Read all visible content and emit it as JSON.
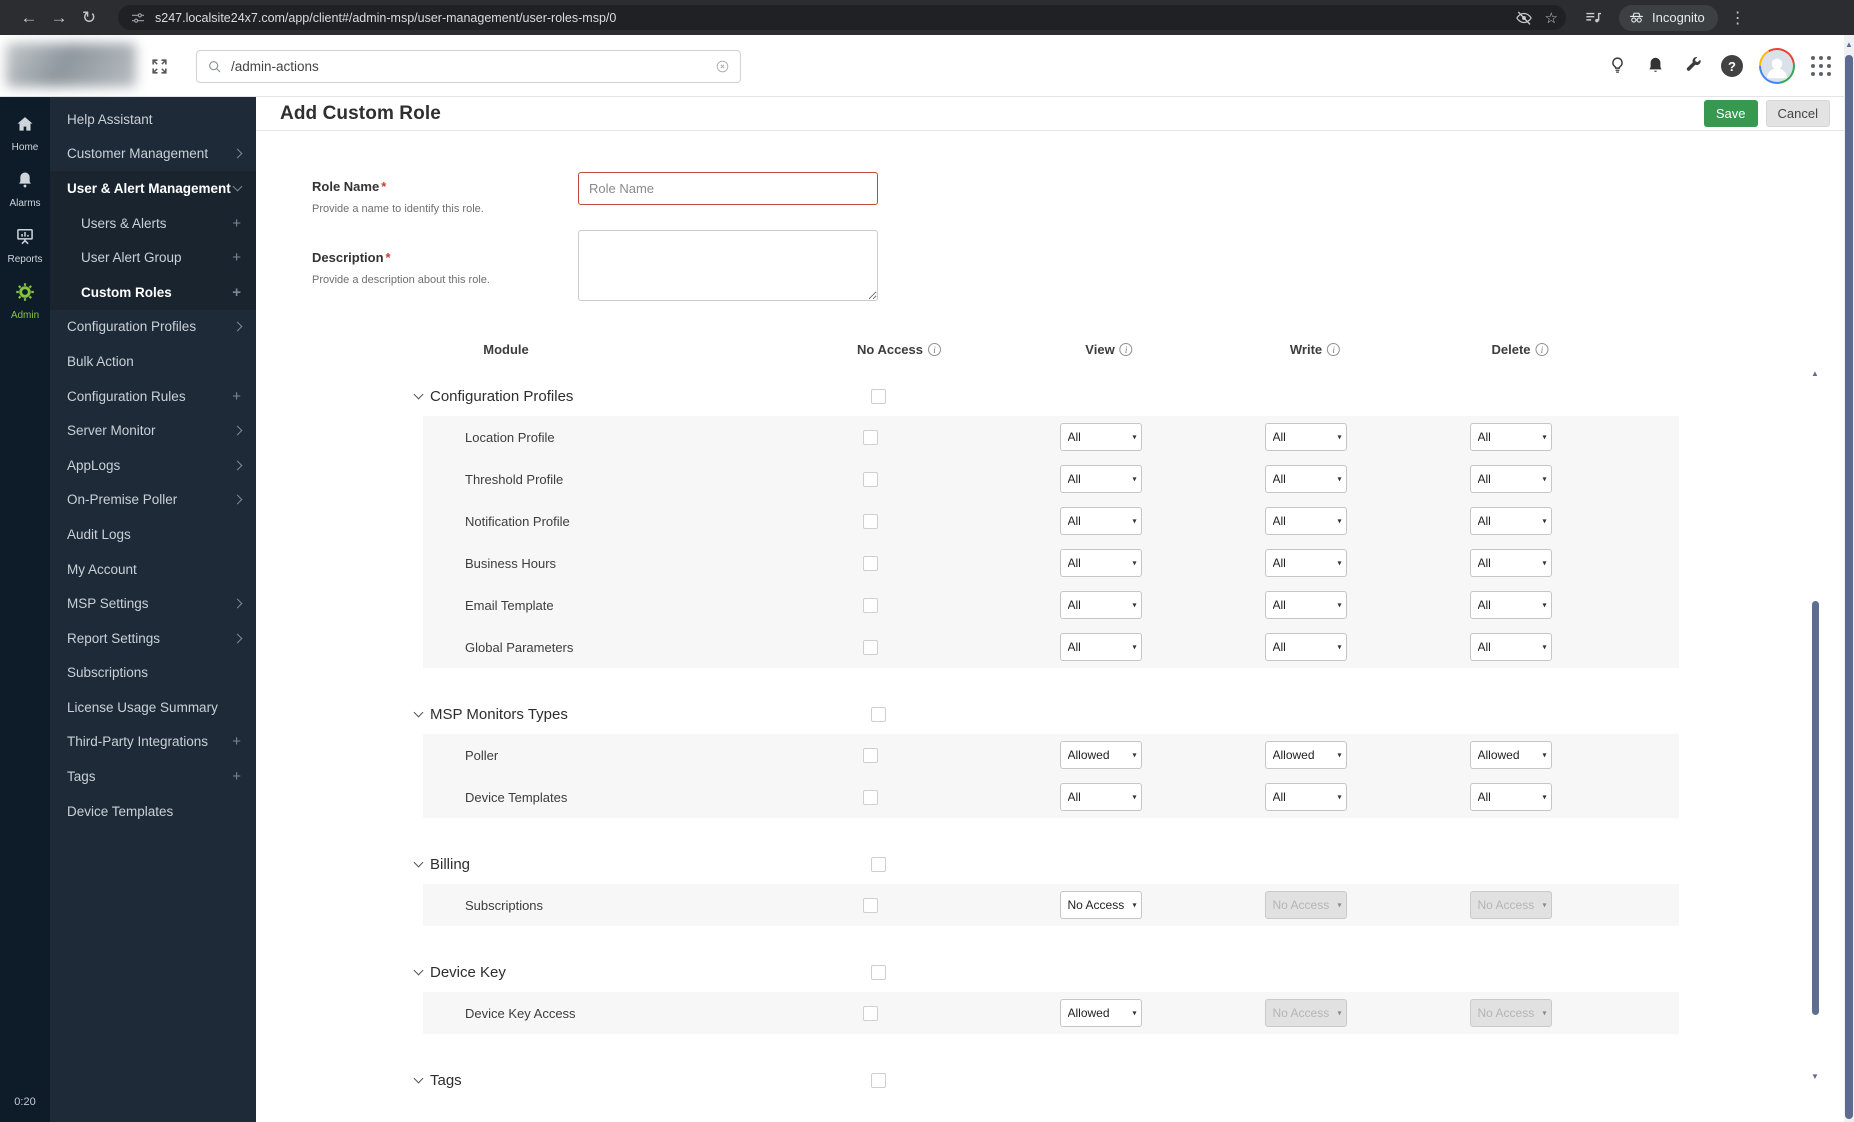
{
  "browser": {
    "back_glyph": "←",
    "forward_glyph": "→",
    "reload_glyph": "↻",
    "url": "s247.localsite24x7.com/app/client#/admin-msp/user-management/user-roles-msp/0",
    "star_glyph": "☆",
    "incognito_label": "Incognito",
    "menu_glyph": "⋮"
  },
  "app_header": {
    "search_value": "/admin-actions"
  },
  "sidebar": {
    "timer": "0:20",
    "rail": [
      {
        "label": "Home",
        "icon": "home-icon",
        "active": false
      },
      {
        "label": "Alarms",
        "icon": "alarms-bell-icon",
        "active": false
      },
      {
        "label": "Reports",
        "icon": "reports-icon",
        "active": false
      },
      {
        "label": "Admin",
        "icon": "admin-gear-icon",
        "active": true
      }
    ],
    "items": [
      {
        "label": "Help Assistant",
        "marker": "none"
      },
      {
        "label": "Customer Management",
        "marker": "chevron"
      },
      {
        "label": "User & Alert Management",
        "marker": "chevron-down",
        "bold": true,
        "group": true
      },
      {
        "label": "Users & Alerts",
        "marker": "plus",
        "child": true,
        "group": true
      },
      {
        "label": "User Alert Group",
        "marker": "plus",
        "child": true,
        "group": true
      },
      {
        "label": "Custom Roles",
        "marker": "plus",
        "child": true,
        "bold": true,
        "group": true
      },
      {
        "label": "Configuration Profiles",
        "marker": "chevron"
      },
      {
        "label": "Bulk Action",
        "marker": "none"
      },
      {
        "label": "Configuration Rules",
        "marker": "plus"
      },
      {
        "label": "Server Monitor",
        "marker": "chevron"
      },
      {
        "label": "AppLogs",
        "marker": "chevron"
      },
      {
        "label": "On-Premise Poller",
        "marker": "chevron"
      },
      {
        "label": "Audit Logs",
        "marker": "none"
      },
      {
        "label": "My Account",
        "marker": "none"
      },
      {
        "label": "MSP Settings",
        "marker": "chevron"
      },
      {
        "label": "Report Settings",
        "marker": "chevron"
      },
      {
        "label": "Subscriptions",
        "marker": "none"
      },
      {
        "label": "License Usage Summary",
        "marker": "none"
      },
      {
        "label": "Third-Party Integrations",
        "marker": "plus"
      },
      {
        "label": "Tags",
        "marker": "plus"
      },
      {
        "label": "Device Templates",
        "marker": "none"
      }
    ]
  },
  "page": {
    "title": "Add Custom Role",
    "save": "Save",
    "cancel": "Cancel"
  },
  "form": {
    "required_marker": "*",
    "role_name_label": "Role Name",
    "role_name_help": "Provide a name to identify this role.",
    "role_name_placeholder": "Role Name",
    "description_label": "Description",
    "description_help": "Provide a description about this role."
  },
  "permissions": {
    "columns": [
      {
        "label": "Module",
        "info": false
      },
      {
        "label": "No Access",
        "info": true
      },
      {
        "label": "View",
        "info": true
      },
      {
        "label": "Write",
        "info": true
      },
      {
        "label": "Delete",
        "info": true
      }
    ],
    "select_caret": "▾",
    "sections": [
      {
        "title": "Configuration Profiles",
        "rows": [
          {
            "label": "Location Profile",
            "view": {
              "value": "All"
            },
            "write": {
              "value": "All"
            },
            "delete": {
              "value": "All"
            }
          },
          {
            "label": "Threshold Profile",
            "view": {
              "value": "All"
            },
            "write": {
              "value": "All"
            },
            "delete": {
              "value": "All"
            }
          },
          {
            "label": "Notification Profile",
            "view": {
              "value": "All"
            },
            "write": {
              "value": "All"
            },
            "delete": {
              "value": "All"
            }
          },
          {
            "label": "Business Hours",
            "view": {
              "value": "All"
            },
            "write": {
              "value": "All"
            },
            "delete": {
              "value": "All"
            }
          },
          {
            "label": "Email Template",
            "view": {
              "value": "All"
            },
            "write": {
              "value": "All"
            },
            "delete": {
              "value": "All"
            }
          },
          {
            "label": "Global Parameters",
            "view": {
              "value": "All"
            },
            "write": {
              "value": "All"
            },
            "delete": {
              "value": "All"
            }
          }
        ]
      },
      {
        "title": "MSP Monitors Types",
        "rows": [
          {
            "label": "Poller",
            "view": {
              "value": "Allowed"
            },
            "write": {
              "value": "Allowed"
            },
            "delete": {
              "value": "Allowed"
            }
          },
          {
            "label": "Device Templates",
            "view": {
              "value": "All"
            },
            "write": {
              "value": "All"
            },
            "delete": {
              "value": "All"
            }
          }
        ]
      },
      {
        "title": "Billing",
        "rows": [
          {
            "label": "Subscriptions",
            "view": {
              "value": "No Access"
            },
            "write": {
              "value": "No Access",
              "disabled": true
            },
            "delete": {
              "value": "No Access",
              "disabled": true
            }
          }
        ]
      },
      {
        "title": "Device Key",
        "rows": [
          {
            "label": "Device Key Access",
            "view": {
              "value": "Allowed"
            },
            "write": {
              "value": "No Access",
              "disabled": true
            },
            "delete": {
              "value": "No Access",
              "disabled": true
            }
          }
        ]
      },
      {
        "title": "Tags",
        "rows": []
      }
    ]
  }
}
